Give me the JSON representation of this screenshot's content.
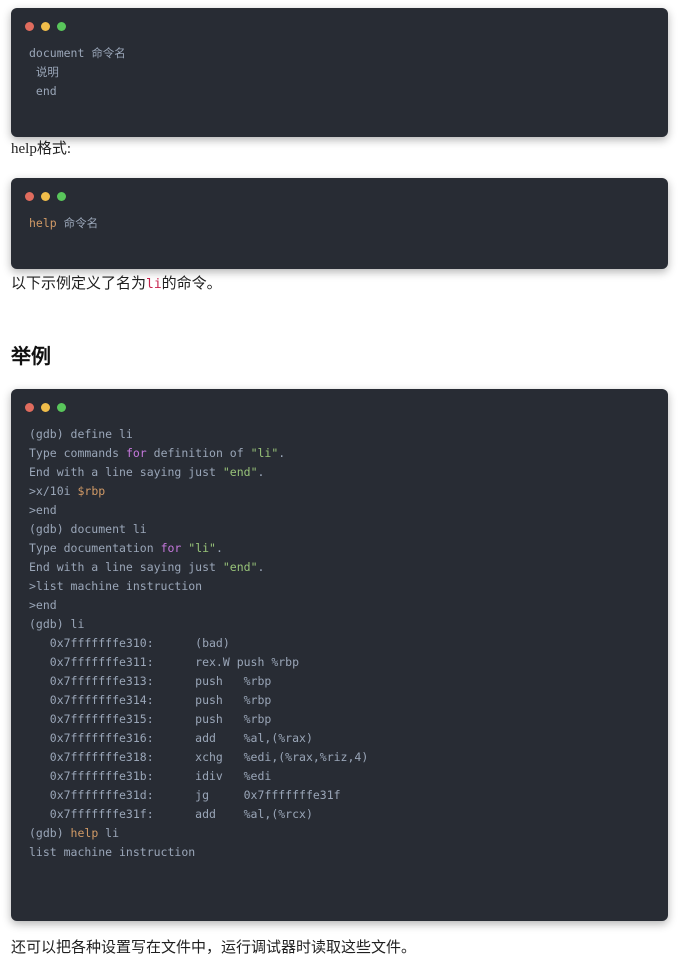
{
  "window_chrome": {
    "dots": [
      "close-dot-red",
      "minimize-dot-yellow",
      "maximize-dot-green"
    ],
    "colors": {
      "red": "#e06c5e",
      "yellow": "#f0bd4a",
      "green": "#59c65b"
    }
  },
  "theme": {
    "code_background": "#282c34",
    "code_foreground": "#9aa6b8",
    "keyword": "#c678dd",
    "string": "#98c379",
    "variable": "#d19a66",
    "page_background": "#ffffff",
    "text": "#1f1f1f"
  },
  "blocks": {
    "document_syntax": {
      "lines": [
        [
          {
            "t": "document ",
            "c": "plain"
          },
          {
            "t": "命令名",
            "c": "plain"
          }
        ],
        [
          {
            "t": " 说明",
            "c": "plain"
          }
        ],
        [
          {
            "t": " end",
            "c": "plain"
          }
        ]
      ]
    },
    "help_syntax": {
      "lines": [
        [
          {
            "t": "help",
            "c": "var"
          },
          {
            "t": " 命令名",
            "c": "plain"
          }
        ]
      ]
    },
    "gdb_session": {
      "lines": [
        [
          {
            "t": "(gdb) define li",
            "c": "plain"
          }
        ],
        [
          {
            "t": "Type commands ",
            "c": "plain"
          },
          {
            "t": "for",
            "c": "kw"
          },
          {
            "t": " definition of ",
            "c": "plain"
          },
          {
            "t": "\"li\"",
            "c": "str"
          },
          {
            "t": ".",
            "c": "plain"
          }
        ],
        [
          {
            "t": "End with a line saying just ",
            "c": "plain"
          },
          {
            "t": "\"end\"",
            "c": "str"
          },
          {
            "t": ".",
            "c": "plain"
          }
        ],
        [
          {
            "t": ">x/10i ",
            "c": "plain"
          },
          {
            "t": "$rbp",
            "c": "var"
          }
        ],
        [
          {
            "t": ">end",
            "c": "plain"
          }
        ],
        [
          {
            "t": "(gdb) document li",
            "c": "plain"
          }
        ],
        [
          {
            "t": "Type documentation ",
            "c": "plain"
          },
          {
            "t": "for",
            "c": "kw"
          },
          {
            "t": " ",
            "c": "plain"
          },
          {
            "t": "\"li\"",
            "c": "str"
          },
          {
            "t": ".",
            "c": "plain"
          }
        ],
        [
          {
            "t": "End with a line saying just ",
            "c": "plain"
          },
          {
            "t": "\"end\"",
            "c": "str"
          },
          {
            "t": ".",
            "c": "plain"
          }
        ],
        [
          {
            "t": ">list machine instruction",
            "c": "plain"
          }
        ],
        [
          {
            "t": ">end",
            "c": "plain"
          }
        ],
        [
          {
            "t": "(gdb) li",
            "c": "plain"
          }
        ],
        [
          {
            "t": "   0x7fffffffe310:      (bad)",
            "c": "plain"
          }
        ],
        [
          {
            "t": "   0x7fffffffe311:      rex.W push %rbp",
            "c": "plain"
          }
        ],
        [
          {
            "t": "   0x7fffffffe313:      push   %rbp",
            "c": "plain"
          }
        ],
        [
          {
            "t": "   0x7fffffffe314:      push   %rbp",
            "c": "plain"
          }
        ],
        [
          {
            "t": "   0x7fffffffe315:      push   %rbp",
            "c": "plain"
          }
        ],
        [
          {
            "t": "   0x7fffffffe316:      add    %al,(%rax)",
            "c": "plain"
          }
        ],
        [
          {
            "t": "   0x7fffffffe318:      xchg   %edi,(%rax,%riz,4)",
            "c": "plain"
          }
        ],
        [
          {
            "t": "   0x7fffffffe31b:      idiv   %edi",
            "c": "plain"
          }
        ],
        [
          {
            "t": "   0x7fffffffe31d:      jg     0x7fffffffe31f",
            "c": "plain"
          }
        ],
        [
          {
            "t": "   0x7fffffffe31f:      add    %al,(%rcx)",
            "c": "plain"
          }
        ],
        [
          {
            "t": "(gdb) ",
            "c": "plain"
          },
          {
            "t": "help",
            "c": "var"
          },
          {
            "t": " li",
            "c": "plain"
          }
        ],
        [
          {
            "t": "list machine instruction",
            "c": "plain"
          }
        ]
      ]
    }
  },
  "text": {
    "help_format_label": "help格式:",
    "example_intro_before": "以下示例定义了名为",
    "example_intro_code": "li",
    "example_intro_after": "的命令。",
    "section_heading": "举例",
    "closing_paragraph": "还可以把各种设置写在文件中，运行调试器时读取这些文件。"
  }
}
